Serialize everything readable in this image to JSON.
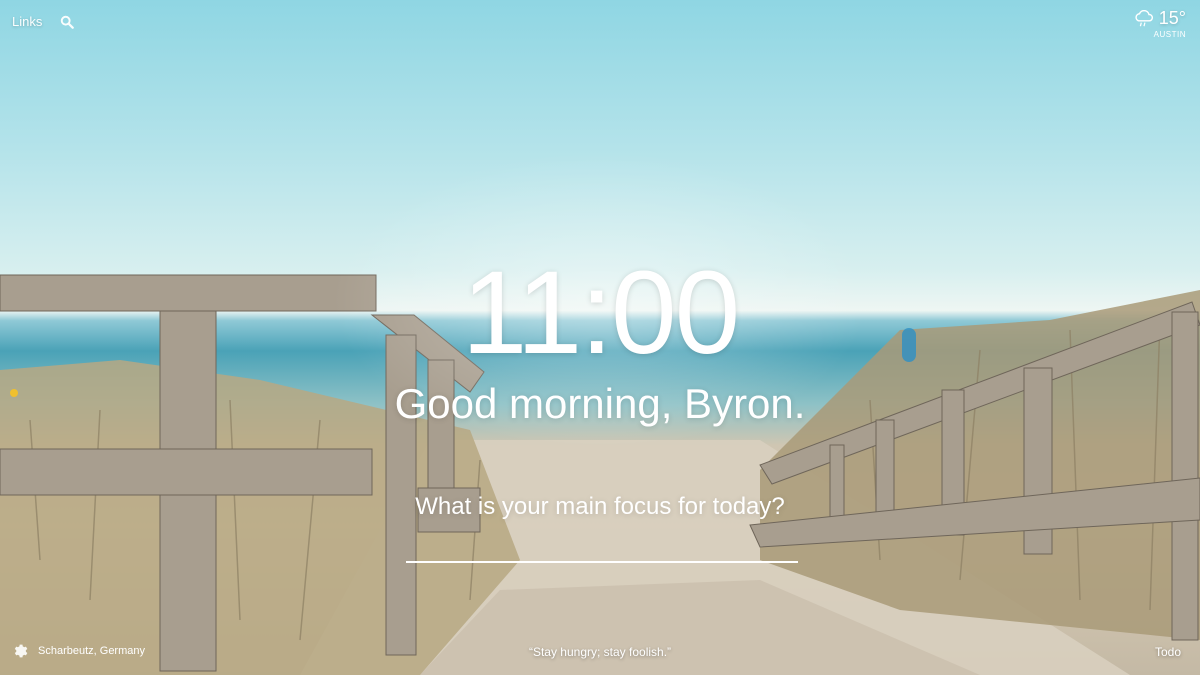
{
  "top_left": {
    "links_label": "Links"
  },
  "weather": {
    "temperature": "15°",
    "city": "AUSTIN",
    "icon": "cloud-rain-icon"
  },
  "main": {
    "time": "11:00",
    "greeting": "Good morning, Byron.",
    "focus_question": "What is your main focus for today?",
    "focus_value": ""
  },
  "bottom": {
    "location": "Scharbeutz, Germany",
    "quote": "“Stay hungry; stay foolish.”",
    "todo_label": "Todo"
  }
}
